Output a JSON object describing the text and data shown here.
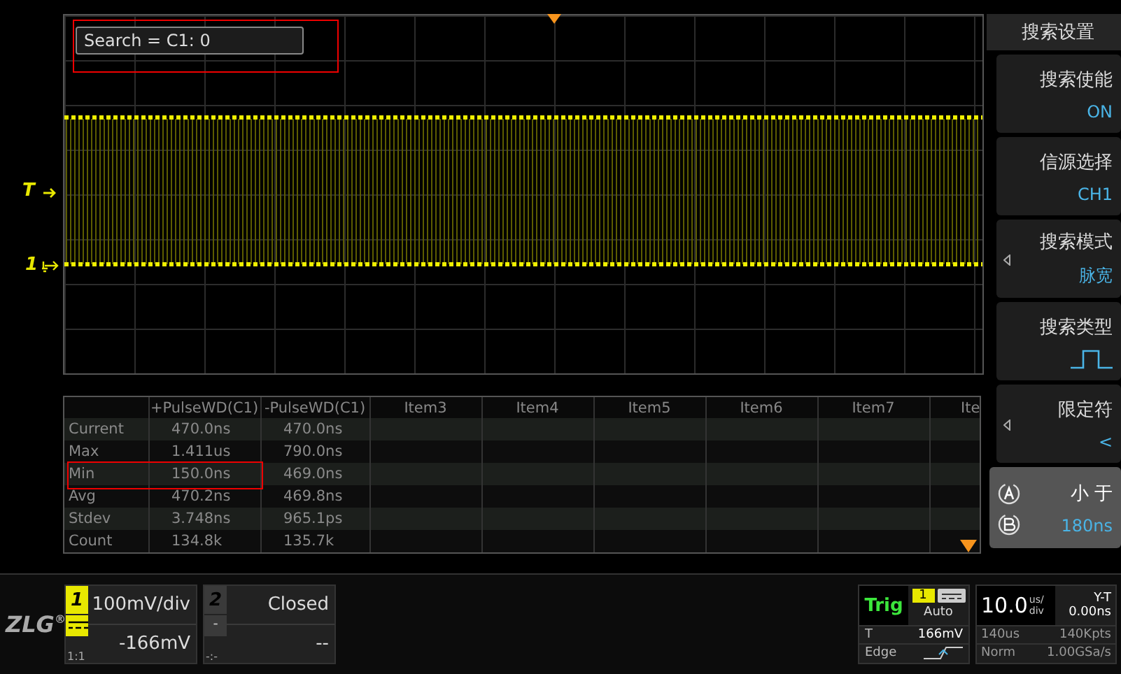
{
  "markers": {
    "trigger_level": "T",
    "channel": "1"
  },
  "search_readout": "Search = C1: 0",
  "table": {
    "columns": [
      "",
      "+PulseWD(C1)",
      "-PulseWD(C1)",
      "Item3",
      "Item4",
      "Item5",
      "Item6",
      "Item7",
      "Ite"
    ],
    "rows": [
      {
        "label": "Current",
        "values": [
          "470.0ns",
          "470.0ns"
        ],
        "highlighted": false
      },
      {
        "label": "Max",
        "values": [
          "1.411us",
          "790.0ns"
        ],
        "highlighted": false
      },
      {
        "label": "Min",
        "values": [
          "150.0ns",
          "469.0ns"
        ],
        "highlighted": true
      },
      {
        "label": "Avg",
        "values": [
          "470.2ns",
          "469.8ns"
        ],
        "highlighted": false
      },
      {
        "label": "Stdev",
        "values": [
          "3.748ns",
          "965.1ps"
        ],
        "highlighted": false
      },
      {
        "label": "Count",
        "values": [
          "134.8k",
          "135.7k"
        ],
        "highlighted": false
      }
    ]
  },
  "menu": {
    "title": "搜索设置",
    "items": [
      {
        "kind": "text",
        "label": "搜索使能",
        "value": "ON",
        "arrow": false,
        "selected": false
      },
      {
        "kind": "text",
        "label": "信源选择",
        "value": "CH1",
        "arrow": false,
        "selected": false
      },
      {
        "kind": "text",
        "label": "搜索模式",
        "value": "脉宽",
        "arrow": true,
        "selected": false
      },
      {
        "kind": "pulse",
        "label": "搜索类型",
        "arrow": false,
        "selected": false
      },
      {
        "kind": "text",
        "label": "限定符",
        "value": "<",
        "arrow": true,
        "selected": false
      },
      {
        "kind": "knob",
        "label": "小 于",
        "value": "180ns",
        "arrow": false,
        "selected": true
      }
    ]
  },
  "logo": {
    "text": "ZLG",
    "mark": "®"
  },
  "channels": [
    {
      "number": "1",
      "on": true,
      "scale": "100mV/div",
      "offset": "-166mV",
      "probe": "1:1"
    },
    {
      "number": "2",
      "on": false,
      "scale": "Closed",
      "offset": "--",
      "probe": "-:-",
      "coupling": "-"
    }
  ],
  "trigger": {
    "label": "Trig",
    "source": "1",
    "mode": "Auto",
    "level_label": "T",
    "level": "166mV",
    "type": "Edge"
  },
  "timebase": {
    "value": "10.0",
    "unit_top": "us/",
    "unit_bottom": "div",
    "format": "Y-T",
    "delay": "0.00ns",
    "span": "140us",
    "depth": "140Kpts",
    "acquire": "Norm",
    "rate": "1.00GSa/s"
  }
}
